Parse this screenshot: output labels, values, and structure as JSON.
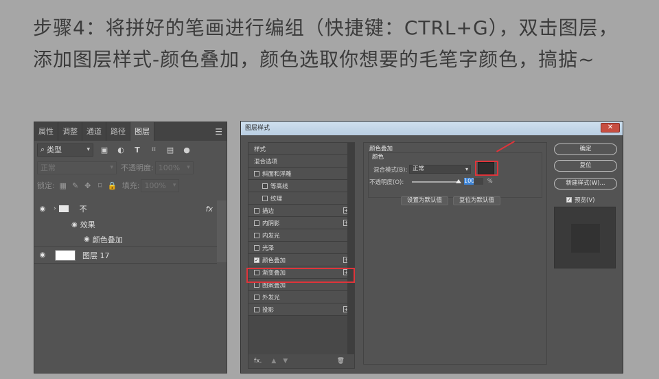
{
  "instruction": "步骤4：将拼好的笔画进行编组（快捷键：CTRL+G），双击图层，添加图层样式-颜色叠加，颜色选取你想要的毛笔字颜色，搞掂~",
  "layers_panel": {
    "tabs": [
      "属性",
      "调整",
      "通道",
      "路径",
      "图层"
    ],
    "active_tab": "图层",
    "filter_label": "类型",
    "blend_mode": "正常",
    "opacity_label": "不透明度:",
    "opacity_value": "100%",
    "lock_label": "锁定:",
    "fill_label": "填充:",
    "fill_value": "100%",
    "layers": [
      {
        "name": "不",
        "type": "group",
        "fx": "fx"
      },
      {
        "name": "效果",
        "type": "effects-header"
      },
      {
        "name": "颜色叠加",
        "type": "effect"
      },
      {
        "name": "图层 17",
        "type": "layer"
      }
    ]
  },
  "dialog": {
    "title": "图层样式",
    "close": "✕",
    "style_list": [
      {
        "label": "样式",
        "check": false,
        "plus": false,
        "header": true
      },
      {
        "label": "混合选项",
        "check": false,
        "plus": false,
        "header": true
      },
      {
        "label": "斜面和浮雕",
        "check": true,
        "checked": false,
        "plus": false
      },
      {
        "label": "等高线",
        "check": true,
        "checked": false,
        "plus": false,
        "indent": true
      },
      {
        "label": "纹理",
        "check": true,
        "checked": false,
        "plus": false,
        "indent": true
      },
      {
        "label": "描边",
        "check": true,
        "checked": false,
        "plus": true
      },
      {
        "label": "内阴影",
        "check": true,
        "checked": false,
        "plus": true
      },
      {
        "label": "内发光",
        "check": true,
        "checked": false,
        "plus": false
      },
      {
        "label": "光泽",
        "check": true,
        "checked": false,
        "plus": false
      },
      {
        "label": "颜色叠加",
        "check": true,
        "checked": true,
        "plus": true
      },
      {
        "label": "渐变叠加",
        "check": true,
        "checked": false,
        "plus": true
      },
      {
        "label": "图案叠加",
        "check": true,
        "checked": false,
        "plus": false
      },
      {
        "label": "外发光",
        "check": true,
        "checked": false,
        "plus": false
      },
      {
        "label": "投影",
        "check": true,
        "checked": false,
        "plus": true
      }
    ],
    "bottom_fx": "fx.",
    "section_title": "颜色叠加",
    "sub_title": "颜色",
    "blend_label": "混合模式(B):",
    "blend_value": "正常",
    "opacity_label": "不透明度(O):",
    "opacity_value": "100",
    "opacity_unit": "%",
    "btn_set_default": "设置为默认值",
    "btn_reset_default": "复位为默认值",
    "btn_ok": "确定",
    "btn_reset": "复位",
    "btn_new_style": "新建样式(W)...",
    "preview_label": "预览(V)",
    "overlay_color": "#2d2d2d"
  }
}
